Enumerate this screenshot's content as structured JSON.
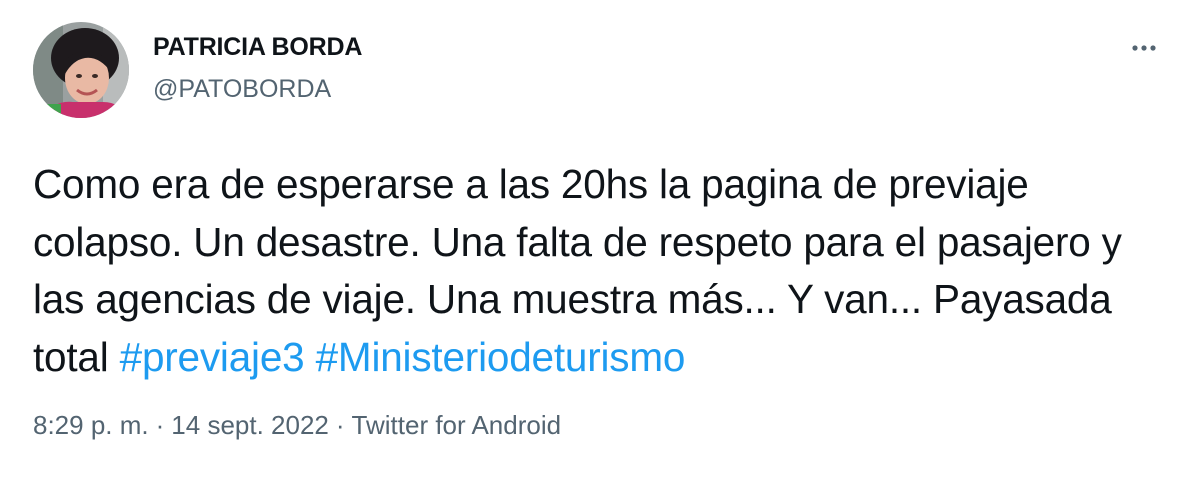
{
  "author": {
    "display_name": "PATRICIA BORDA",
    "handle": "@PATOBORDA",
    "avatar_icon": "profile-photo"
  },
  "menu": {
    "icon": "more-horizontal-icon"
  },
  "tweet": {
    "text": "Como era de esperarse a las 20hs la pagina de previaje colapso. Un desastre. Una falta de respeto para el pasajero y las agencias de viaje. Una muestra más... Y van... Payasada total",
    "hashtags": [
      "#previaje3",
      "#Ministeriodeturismo"
    ]
  },
  "meta": {
    "time": "8:29 p. m.",
    "separator": "·",
    "date": "14 sept. 2022",
    "source": "Twitter for Android"
  },
  "colors": {
    "text": "#0f1419",
    "secondary": "#536471",
    "link": "#1d9bf0"
  }
}
